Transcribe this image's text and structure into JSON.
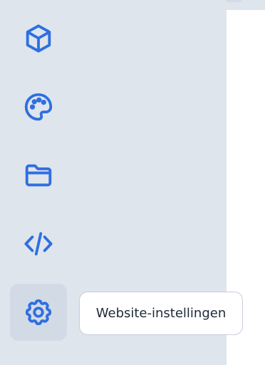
{
  "theme": {
    "icon_color": "#2f6fe0",
    "sidebar_bg": "#dfe5ed",
    "active_bg": "#d2dae5",
    "panel_bg": "#ffffff"
  },
  "sidebar": {
    "items": [
      {
        "icon": "cube-icon",
        "active": false
      },
      {
        "icon": "palette-icon",
        "active": false
      },
      {
        "icon": "folder-icon",
        "active": false
      },
      {
        "icon": "code-icon",
        "active": false
      },
      {
        "icon": "gear-icon",
        "active": true
      }
    ]
  },
  "tooltip": {
    "text": "Website-instellingen"
  }
}
